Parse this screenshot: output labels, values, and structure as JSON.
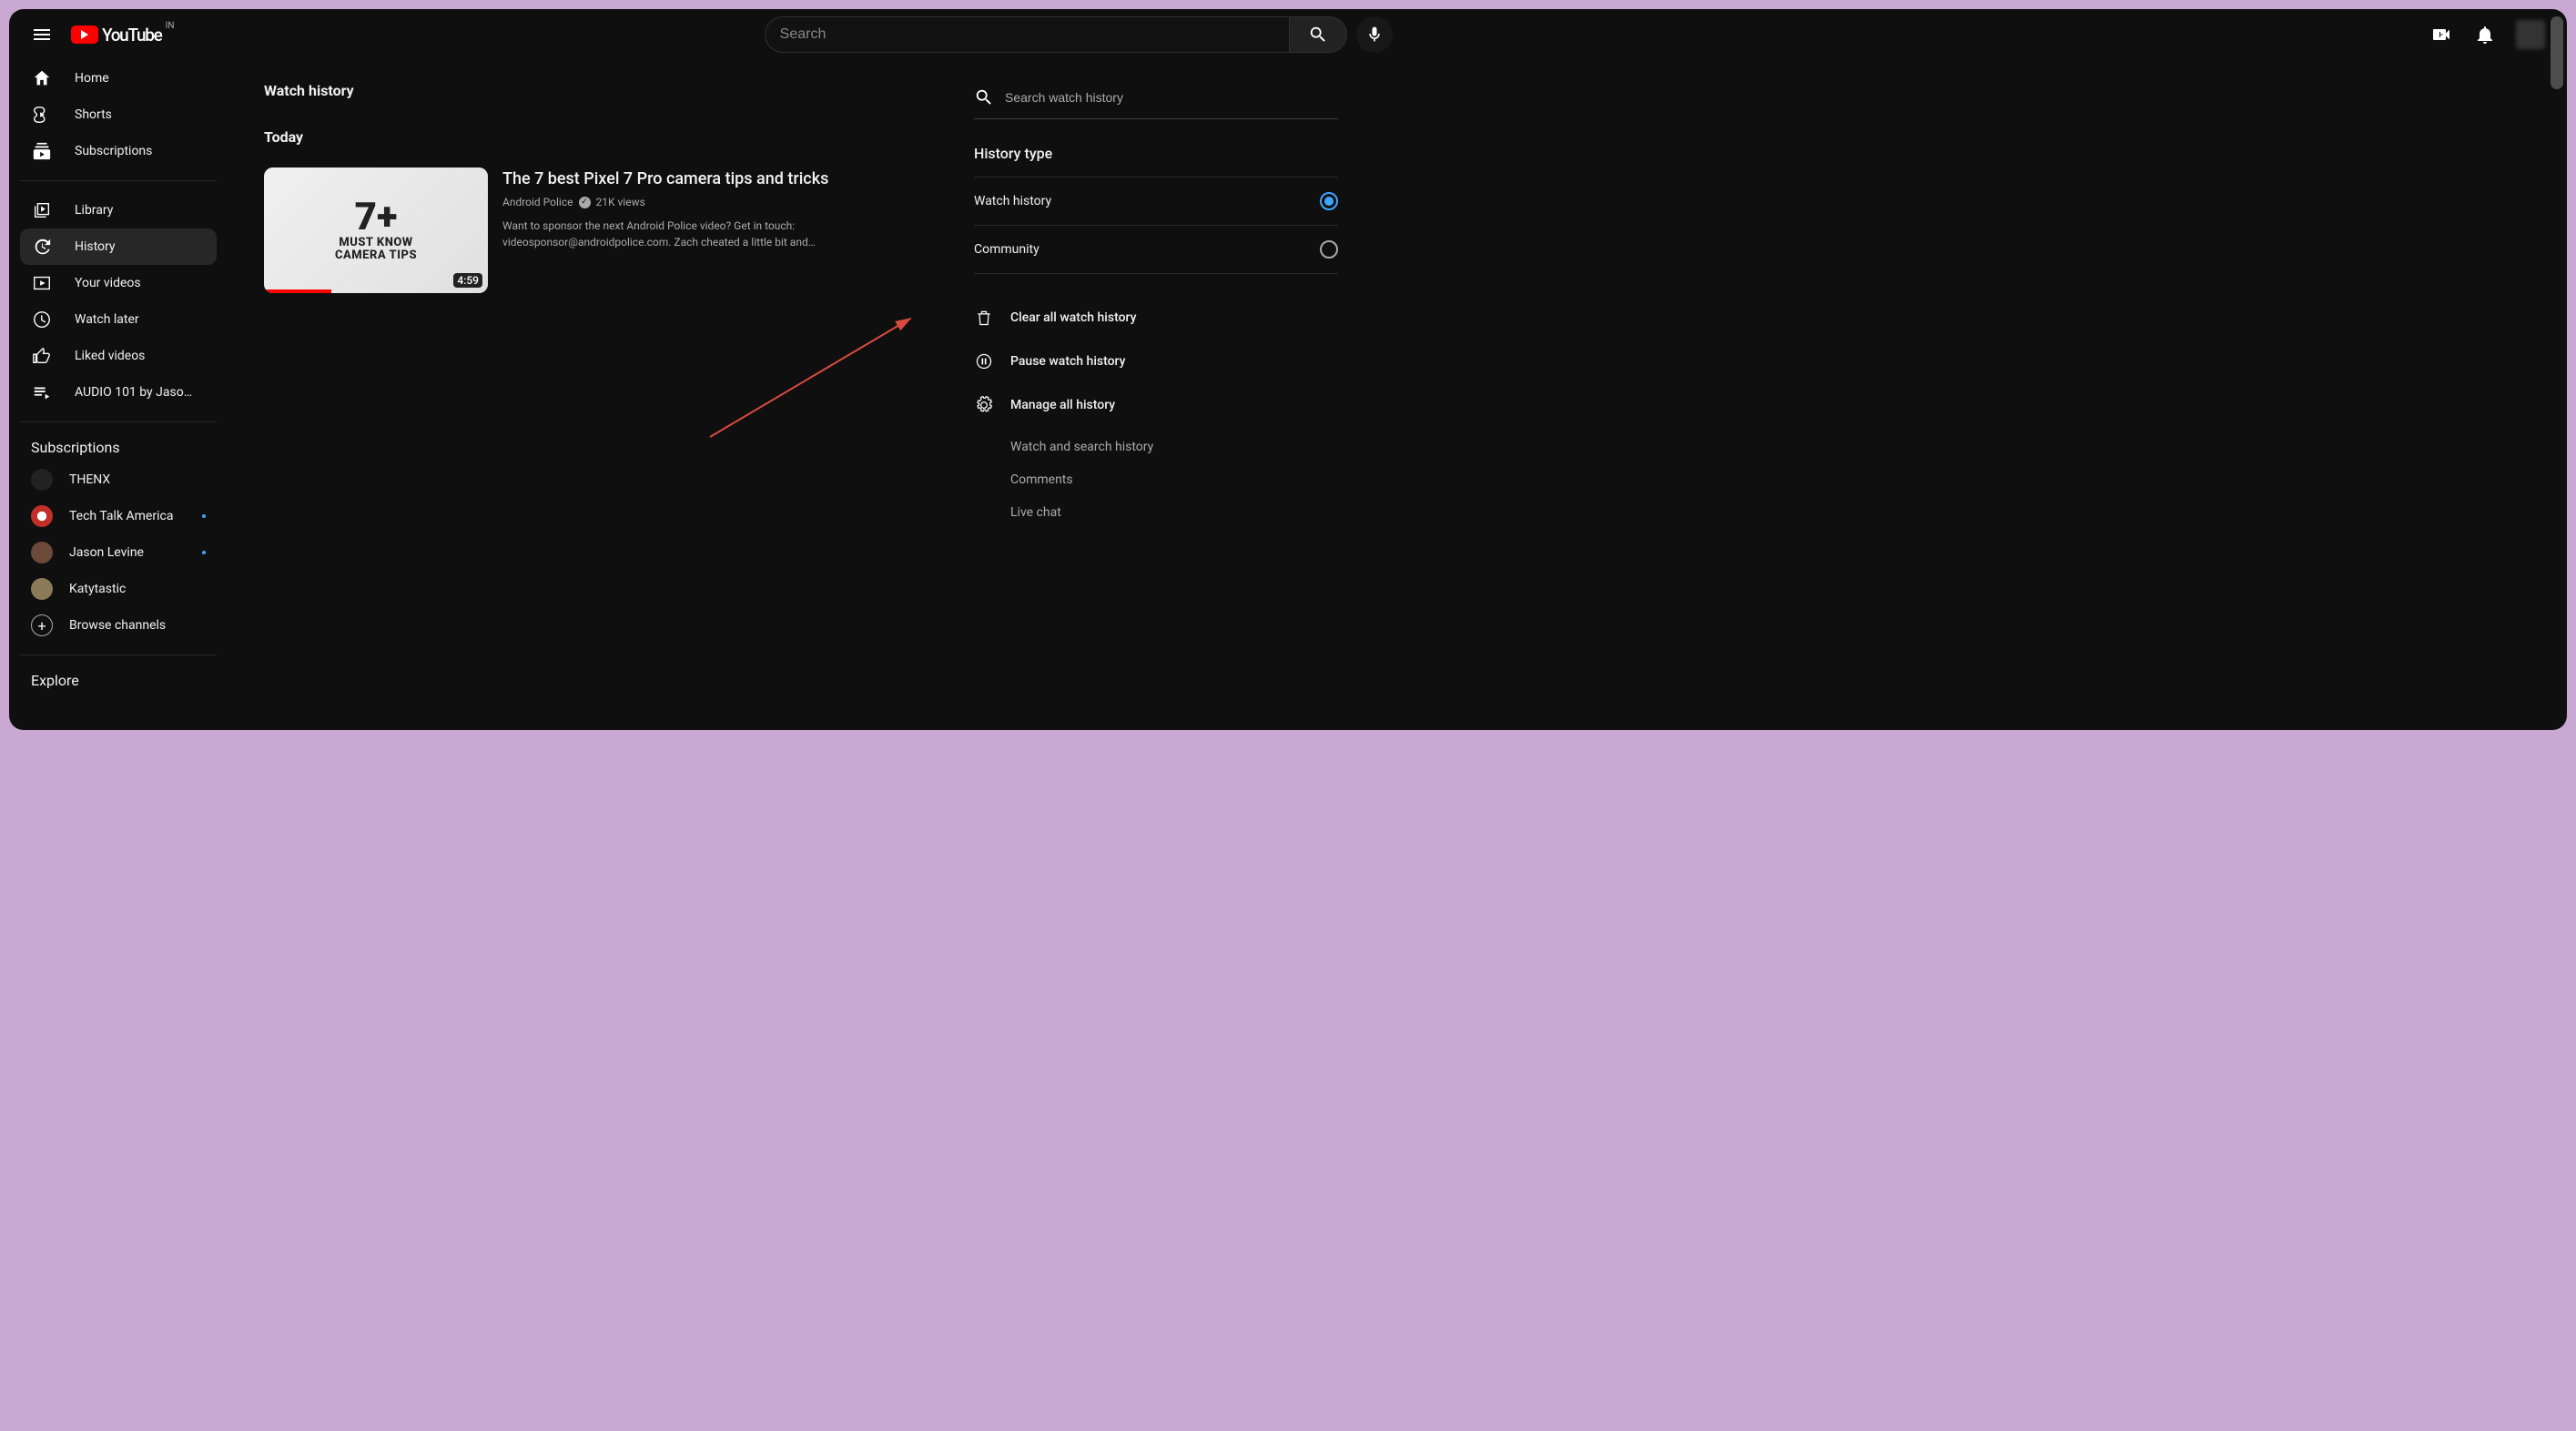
{
  "header": {
    "country_code": "IN",
    "logo_text": "YouTube",
    "search_placeholder": "Search"
  },
  "sidebar": {
    "primary": [
      {
        "label": "Home",
        "icon": "home-icon"
      },
      {
        "label": "Shorts",
        "icon": "shorts-icon"
      },
      {
        "label": "Subscriptions",
        "icon": "subscriptions-icon"
      }
    ],
    "secondary": [
      {
        "label": "Library",
        "icon": "library-icon"
      },
      {
        "label": "History",
        "icon": "history-icon",
        "active": true
      },
      {
        "label": "Your videos",
        "icon": "your-videos-icon"
      },
      {
        "label": "Watch later",
        "icon": "watch-later-icon"
      },
      {
        "label": "Liked videos",
        "icon": "liked-videos-icon"
      },
      {
        "label": "AUDIO 101 by Jaso…",
        "icon": "playlist-icon"
      }
    ],
    "subs_title": "Subscriptions",
    "subscriptions": [
      {
        "label": "THENX",
        "dot": false,
        "color": "#222"
      },
      {
        "label": "Tech Talk America",
        "dot": true,
        "color": "#c03028"
      },
      {
        "label": "Jason Levine",
        "dot": true,
        "color": "#6b4a3a"
      },
      {
        "label": "Katytastic",
        "dot": false,
        "color": "#8a7a5a"
      }
    ],
    "browse_label": "Browse channels",
    "explore_title": "Explore"
  },
  "main": {
    "page_title": "Watch history",
    "day_label": "Today",
    "video": {
      "title": "The 7 best Pixel 7 Pro camera tips and tricks",
      "channel": "Android Police",
      "views": "21K views",
      "desc": "Want to sponsor the next Android Police video? Get in touch: videosponsor@androidpolice.com. Zach cheated a little bit and…",
      "duration": "4:59",
      "thumb_num": "7+",
      "thumb_line1": "MUST KNOW",
      "thumb_line2": "CAMERA TIPS"
    }
  },
  "panel": {
    "search_placeholder": "Search watch history",
    "type_title": "History type",
    "type_options": [
      {
        "label": "Watch history",
        "checked": true
      },
      {
        "label": "Community",
        "checked": false
      }
    ],
    "actions": {
      "clear": "Clear all watch history",
      "pause": "Pause watch history",
      "manage": "Manage all history"
    },
    "sub_links": [
      "Watch and search history",
      "Comments",
      "Live chat"
    ]
  }
}
